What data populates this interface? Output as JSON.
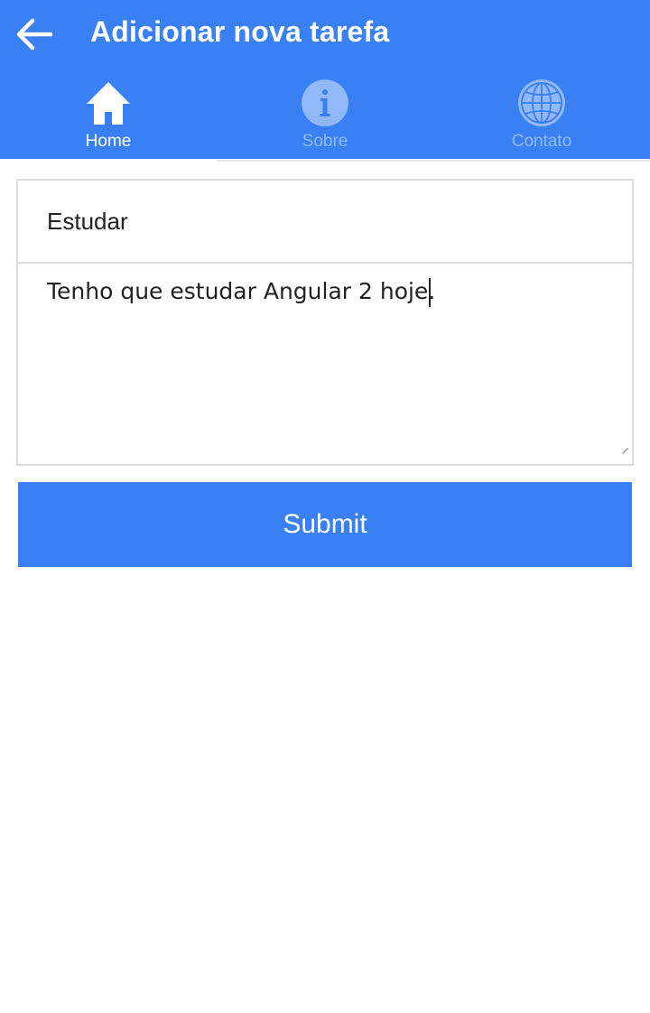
{
  "header": {
    "title": "Adicionar nova tarefa",
    "back_icon": "arrow-left-icon"
  },
  "tabs": [
    {
      "label": "Home",
      "icon": "home-icon",
      "active": true
    },
    {
      "label": "Sobre",
      "icon": "info-icon",
      "active": false
    },
    {
      "label": "Contato",
      "icon": "globe-icon",
      "active": false
    }
  ],
  "form": {
    "title_value": "Estudar",
    "description_value": "Tenho que estudar Angular 2 hoje.",
    "submit_label": "Submit"
  },
  "colors": {
    "primary": "#3880f4",
    "text": "#222222",
    "border": "#dddddd"
  }
}
